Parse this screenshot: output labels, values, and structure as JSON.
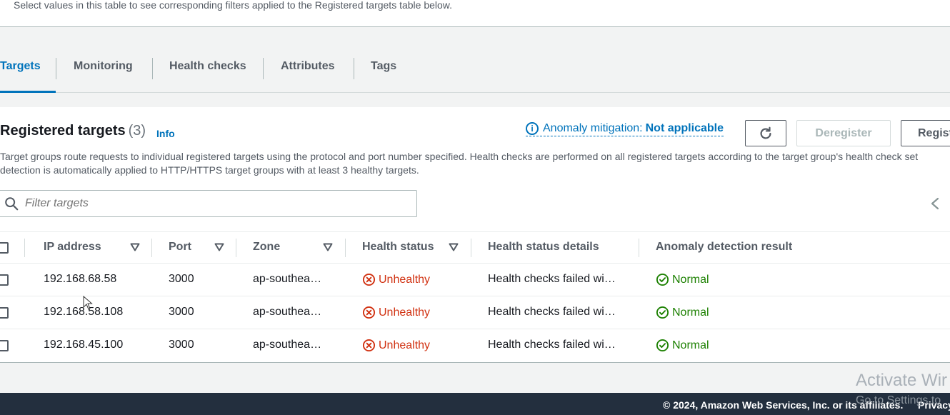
{
  "top": {
    "hint": "Select values in this table to see corresponding filters applied to the Registered targets table below."
  },
  "tabs": [
    {
      "label": "Targets",
      "active": true
    },
    {
      "label": "Monitoring",
      "active": false
    },
    {
      "label": "Health checks",
      "active": false
    },
    {
      "label": "Attributes",
      "active": false
    },
    {
      "label": "Tags",
      "active": false
    }
  ],
  "registered": {
    "title": "Registered targets",
    "count": "(3)",
    "info": "Info",
    "anomaly_label": "Anomaly mitigation:",
    "anomaly_value": "Not applicable",
    "deregister": "Deregister",
    "register": "Regist",
    "desc_line1": "Target groups route requests to individual registered targets using the protocol and port number specified. Health checks are performed on all registered targets according to the target group's health check set",
    "desc_line2": "detection is automatically applied to HTTP/HTTPS target groups with at least 3 healthy targets.",
    "filter_placeholder": "Filter targets"
  },
  "table": {
    "columns": [
      "IP address",
      "Port",
      "Zone",
      "Health status",
      "Health status details",
      "Anomaly detection result"
    ],
    "rows": [
      {
        "ip": "192.168.68.58",
        "port": "3000",
        "zone": "ap-southea…",
        "health": "Unhealthy",
        "details": "Health checks failed wi…",
        "anomaly": "Normal"
      },
      {
        "ip": "192.168.58.108",
        "port": "3000",
        "zone": "ap-southea…",
        "health": "Unhealthy",
        "details": "Health checks failed wi…",
        "anomaly": "Normal"
      },
      {
        "ip": "192.168.45.100",
        "port": "3000",
        "zone": "ap-southea…",
        "health": "Unhealthy",
        "details": "Health checks failed wi…",
        "anomaly": "Normal"
      }
    ]
  },
  "footer": {
    "copyright": "© 2024, Amazon Web Services, Inc. or its affiliates.",
    "privacy": "Privacy"
  },
  "watermark": {
    "line1": "Activate Wir",
    "line2": "Go to Settings to"
  },
  "colors": {
    "accent": "#0073bb",
    "unhealthy": "#d13212",
    "normal": "#1d8102",
    "footer_bg": "#232f3e"
  },
  "icons": [
    "info-icon",
    "refresh-icon",
    "search-icon",
    "chevron-left-icon",
    "sort-down-icon",
    "error-circle-icon",
    "check-circle-icon"
  ]
}
